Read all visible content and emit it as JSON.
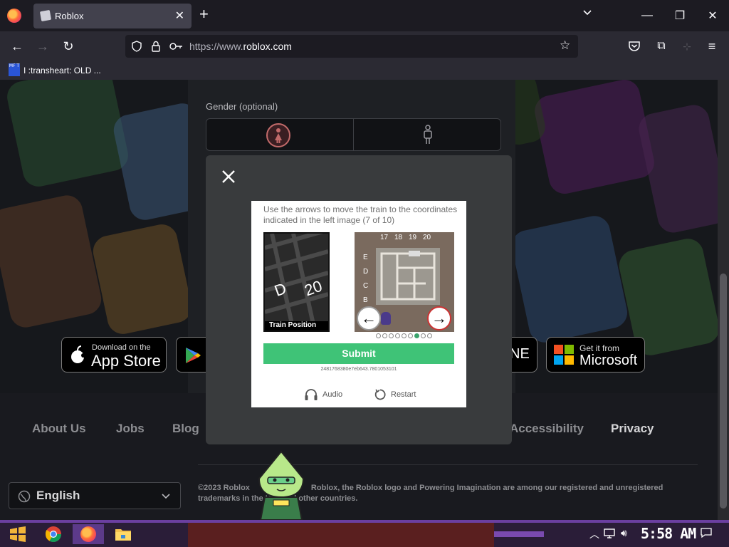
{
  "browser": {
    "tab_title": "Roblox",
    "tab_close": "✕",
    "new_tab": "+",
    "url_prefix": "https://www.",
    "url_domain": "roblox.com",
    "bookmark_icon_text": "MF T",
    "bookmark_label": "I :transheart: OLD ...",
    "window_controls": {
      "minimize": "—",
      "restore": "❐",
      "close": "✕"
    }
  },
  "signup": {
    "gender_label": "Gender (optional)"
  },
  "stores": {
    "appstore_top": "Download on the",
    "appstore_bottom": "App Store",
    "microsoft_top": "Get it from",
    "microsoft_bottom": "Microsoft",
    "partial_store": "NE"
  },
  "footer": {
    "links": [
      "About Us",
      "Jobs",
      "Blog",
      "Accessibility",
      "Privacy"
    ],
    "language": "English",
    "copyright_line1_a": "©2023 Roblox",
    "copyright_line1_b": "Roblox, the Roblox logo and Powering Imagination are among our registered and unregistered",
    "copyright_line2_a": "trademarks in the U",
    "copyright_line2_b": "and other countries."
  },
  "captcha": {
    "instruction": "Use the arrows to move the train to the coordinates indicated in the left image (7 of 10)",
    "left_image_caption": "Train Position",
    "left_image_letter": "D",
    "left_image_number": "20",
    "grid_columns": [
      "17",
      "18",
      "19",
      "20"
    ],
    "grid_rows": [
      "E",
      "D",
      "C",
      "B"
    ],
    "left_arrow": "←",
    "right_arrow": "→",
    "page_count": 9,
    "active_page": 7,
    "submit_label": "Submit",
    "session_id": "2481768380e7eb643.7801053101",
    "audio_label": "Audio",
    "restart_label": "Restart"
  },
  "taskbar": {
    "clock": "5:58 AM",
    "icons": [
      "start-icon",
      "chrome-icon",
      "firefox-icon",
      "file-explorer-icon"
    ]
  }
}
